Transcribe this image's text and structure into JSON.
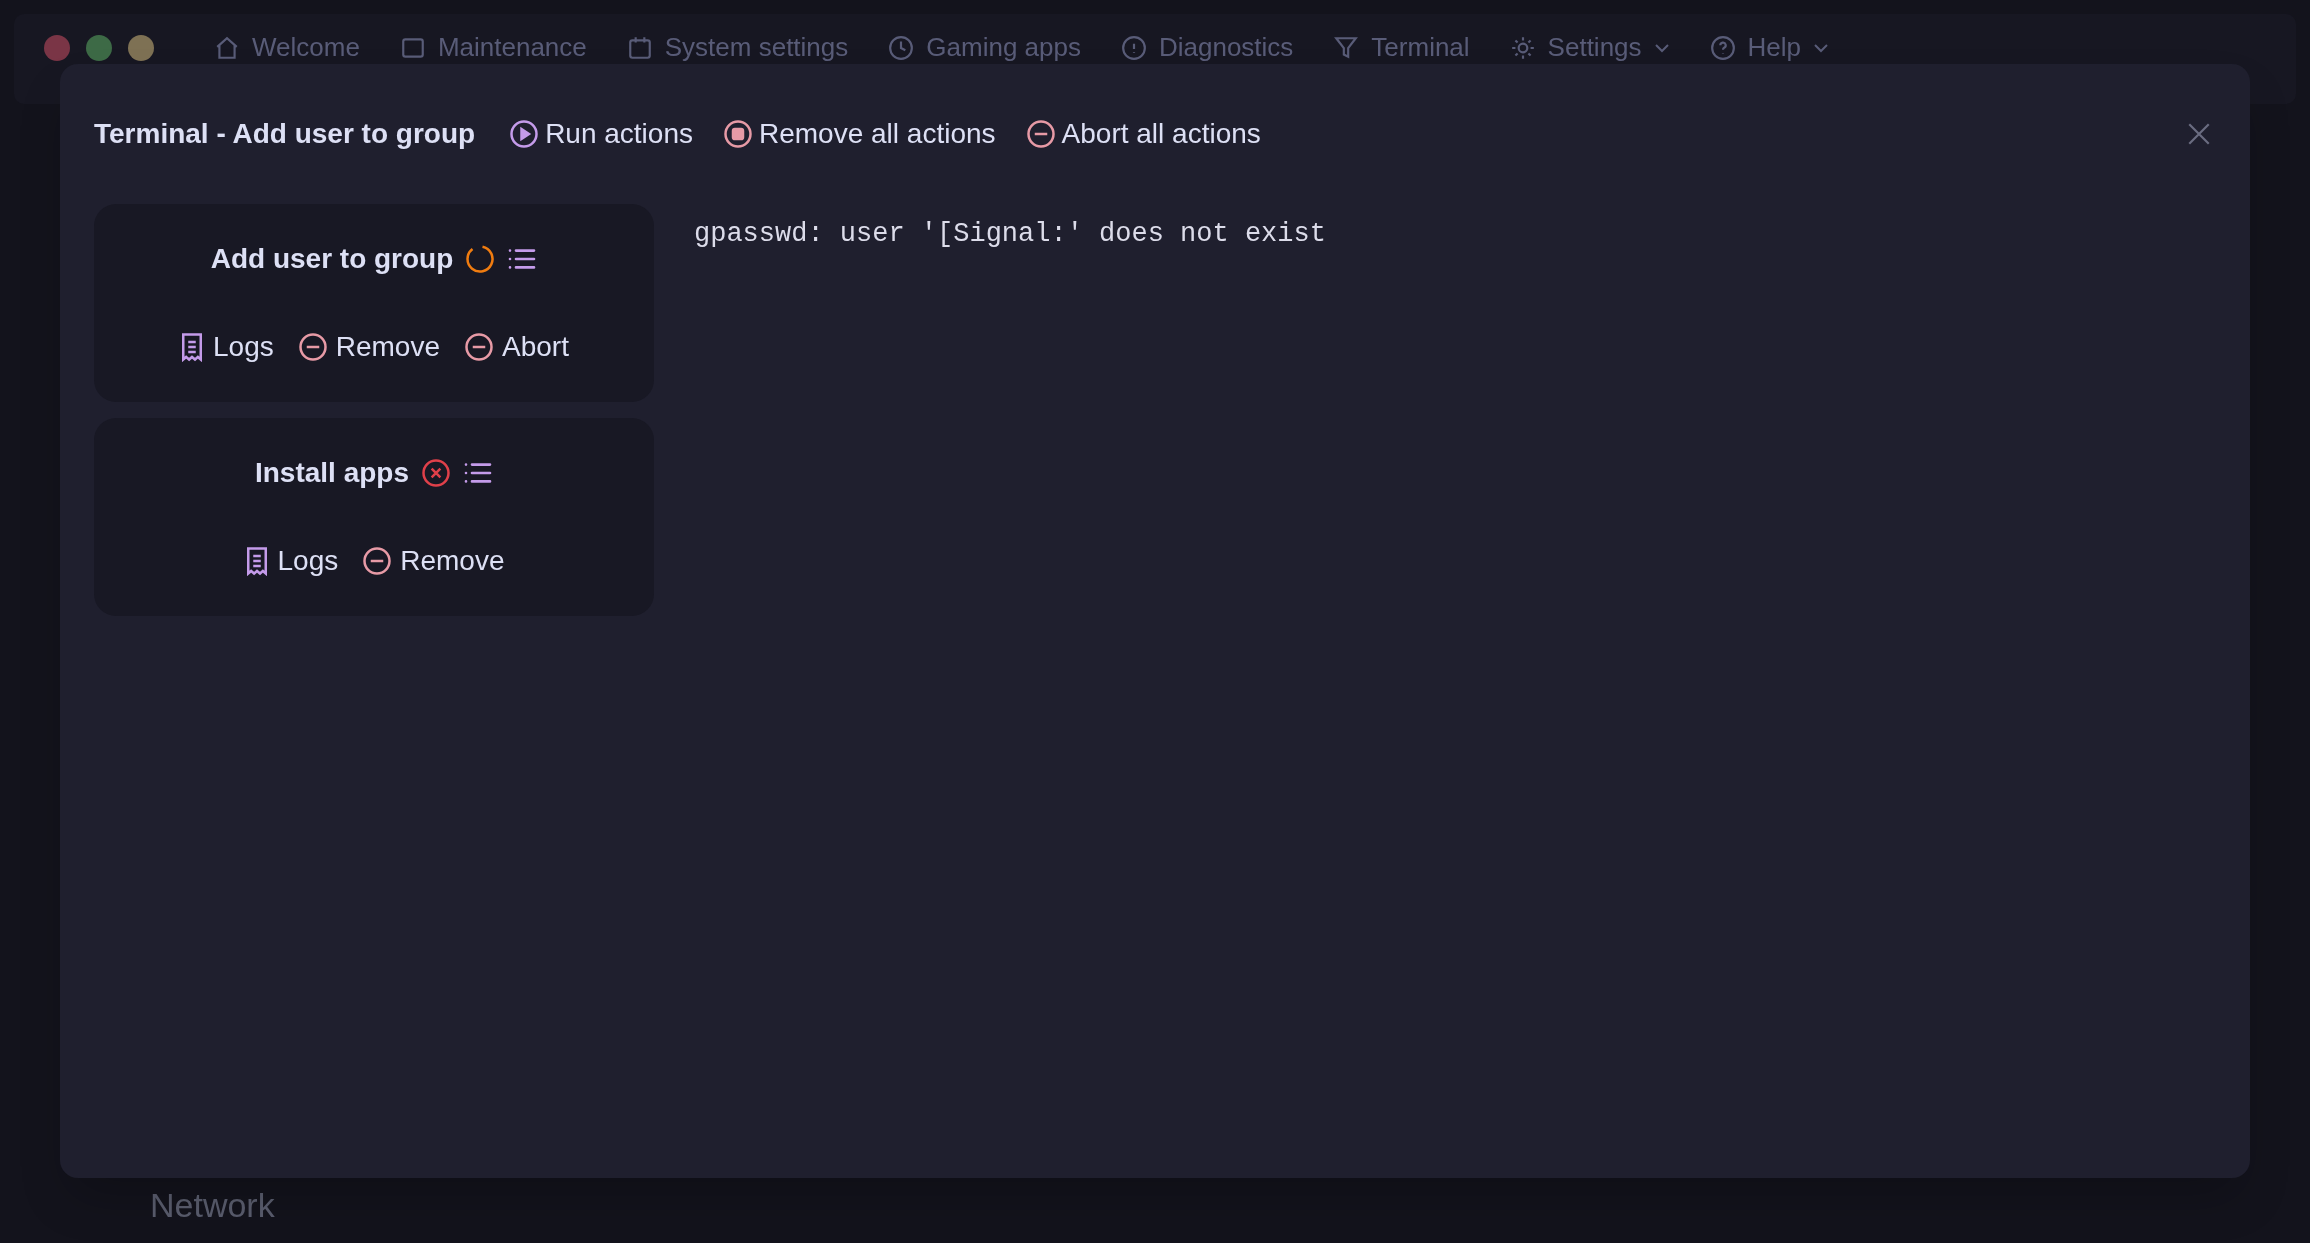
{
  "window_controls": [
    {
      "color": "#7a3546"
    },
    {
      "color": "#3d6a46"
    },
    {
      "color": "#7e7154"
    }
  ],
  "nav": [
    {
      "label": "Welcome",
      "kind": "link"
    },
    {
      "label": "Maintenance",
      "kind": "link"
    },
    {
      "label": "System settings",
      "kind": "link"
    },
    {
      "label": "Gaming apps",
      "kind": "link"
    },
    {
      "label": "Diagnostics",
      "kind": "link"
    },
    {
      "label": "Terminal",
      "kind": "link"
    },
    {
      "label": "Settings",
      "kind": "menu"
    },
    {
      "label": "Help",
      "kind": "menu"
    }
  ],
  "dialog": {
    "title": "Terminal - Add user to group",
    "toolbar": [
      {
        "label": "Run actions",
        "kind": "run"
      },
      {
        "label": "Remove all actions",
        "kind": "remove"
      },
      {
        "label": "Abort all actions",
        "kind": "abort"
      }
    ],
    "actions": [
      {
        "name": "Add user to group",
        "kind": "running",
        "buttons": [
          {
            "label": "Logs",
            "kind": "logs"
          },
          {
            "label": "Remove",
            "kind": "remove"
          },
          {
            "label": "Abort",
            "kind": "abort"
          }
        ]
      },
      {
        "name": "Install apps",
        "kind": "failed",
        "buttons": [
          {
            "label": "Logs",
            "kind": "logs"
          },
          {
            "label": "Remove",
            "kind": "remove"
          }
        ]
      }
    ],
    "output": "gpasswd: user '[Signal:' does not exist"
  },
  "background_heading": "Network"
}
